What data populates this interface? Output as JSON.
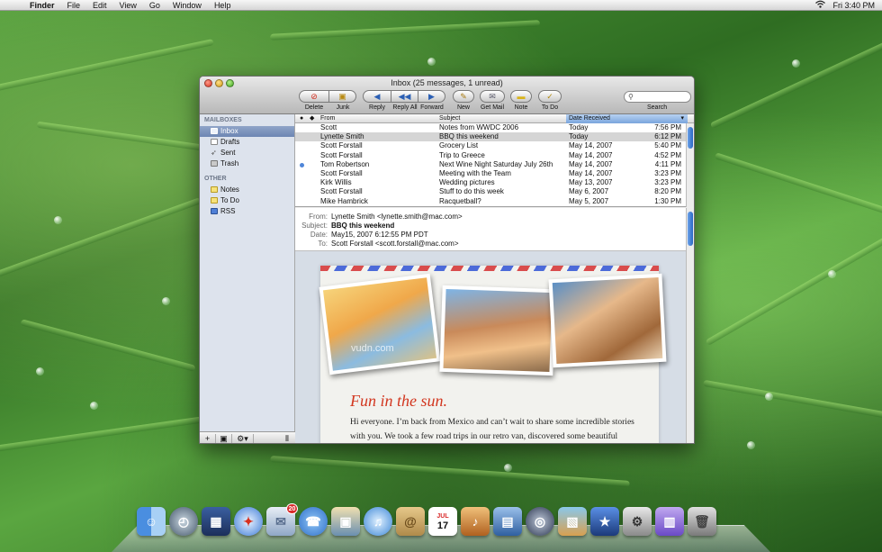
{
  "menubar": {
    "apple": "",
    "app": "Finder",
    "items": [
      "File",
      "Edit",
      "View",
      "Go",
      "Window",
      "Help"
    ],
    "clock": "Fri 3:40 PM"
  },
  "window": {
    "title": "Inbox (25 messages, 1 unread)",
    "toolbar": {
      "delete": "Delete",
      "junk": "Junk",
      "reply": "Reply",
      "reply_all": "Reply All",
      "forward": "Forward",
      "new": "New",
      "get_mail": "Get Mail",
      "note": "Note",
      "todo": "To Do",
      "search_label": "Search",
      "search_placeholder": ""
    }
  },
  "sidebar": {
    "mailboxes_header": "MAILBOXES",
    "mailboxes": [
      {
        "label": "Inbox",
        "selected": true
      },
      {
        "label": "Drafts"
      },
      {
        "label": "Sent"
      },
      {
        "label": "Trash"
      }
    ],
    "other_header": "OTHER",
    "other": [
      {
        "label": "Notes"
      },
      {
        "label": "To Do"
      },
      {
        "label": "RSS"
      }
    ]
  },
  "list": {
    "columns": {
      "from": "From",
      "subject": "Subject",
      "date": "Date Received"
    },
    "rows": [
      {
        "from": "Scott",
        "subject": "Notes from WWDC 2006",
        "date": "Today",
        "time": "7:56 PM"
      },
      {
        "from": "Lynette Smith",
        "subject": "BBQ this weekend",
        "date": "Today",
        "time": "6:12 PM",
        "selected": true
      },
      {
        "from": "Scott Forstall",
        "subject": "Grocery List",
        "date": "May 14, 2007",
        "time": "5:40 PM"
      },
      {
        "from": "Scott Forstall",
        "subject": "Trip to Greece",
        "date": "May 14, 2007",
        "time": "4:52 PM"
      },
      {
        "from": "Tom Robertson",
        "subject": "Next Wine Night Saturday July 26th",
        "date": "May 14, 2007",
        "time": "4:11 PM",
        "unread": true
      },
      {
        "from": "Scott Forstall",
        "subject": "Meeting with the Team",
        "date": "May 14, 2007",
        "time": "3:23 PM"
      },
      {
        "from": "Kirk Willis",
        "subject": "Wedding pictures",
        "date": "May 13, 2007",
        "time": "3:23 PM"
      },
      {
        "from": "Scott Forstall",
        "subject": "Stuff to do this week",
        "date": "May 6, 2007",
        "time": "8:20 PM"
      },
      {
        "from": "Mike Hambrick",
        "subject": "Racquetball?",
        "date": "May 5, 2007",
        "time": "1:30 PM"
      }
    ]
  },
  "message": {
    "from_label": "From:",
    "from": "Lynette Smith <lynette.smith@mac.com>",
    "subject_label": "Subject:",
    "subject": "BBQ this weekend",
    "date_label": "Date:",
    "date": "May15, 2007 6:12:55 PM PDT",
    "to_label": "To:",
    "to": "Scott Forstall <scott.forstall@mac.com>",
    "heading": "Fun in the sun.",
    "body": "Hi everyone. I’m back from Mexico and can’t wait to share some incredible stories with you. We took a few road trips in our retro van, discovered some beautiful",
    "watermark": "vudn.com"
  },
  "dock": {
    "mail_badge": "20",
    "calendar_month": "JUL",
    "calendar_day": "17"
  },
  "colors": {
    "selection": "#6d86b3",
    "date_column": "#7aa5dc",
    "heading_red": "#d2361f",
    "badge_red": "#d92b2b"
  }
}
